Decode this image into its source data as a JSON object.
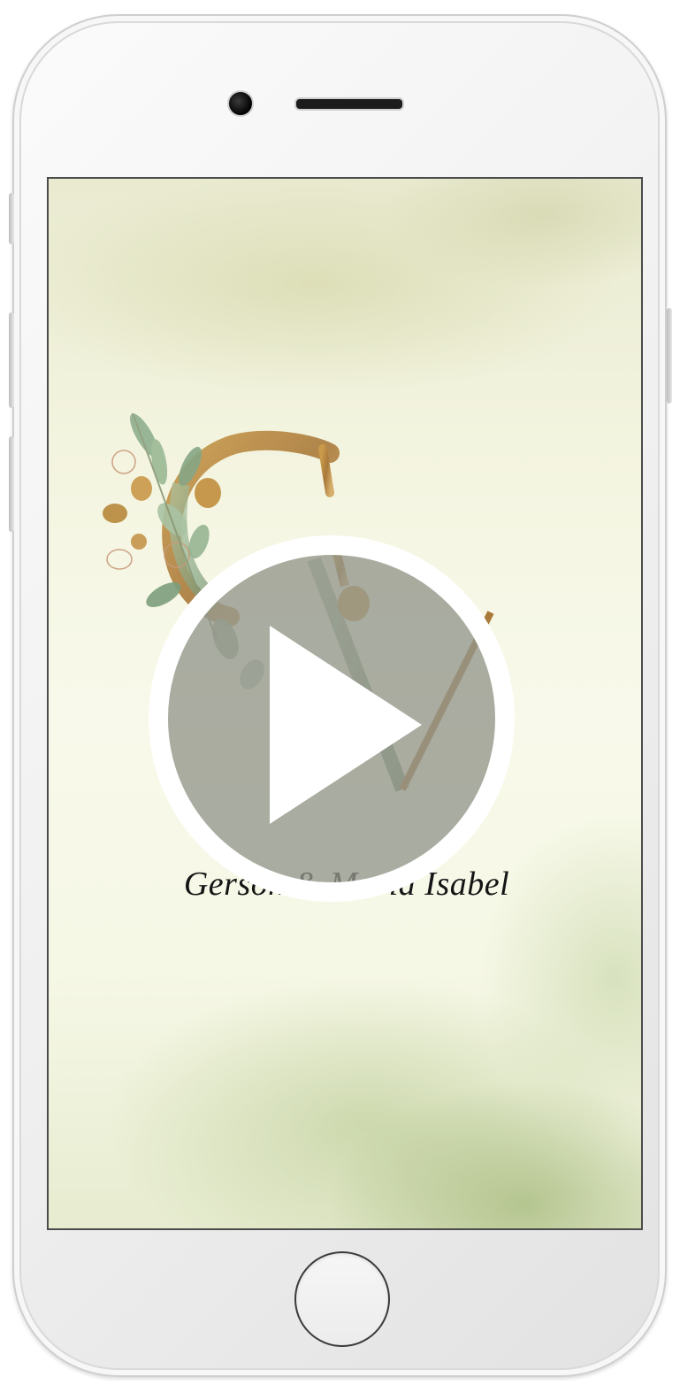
{
  "invitation": {
    "monogram_letters": "GM",
    "couple_names": "Gerson & Maria Isabel"
  },
  "video": {
    "state": "paused"
  },
  "icons": {
    "play": "play-icon",
    "camera": "front-camera-icon",
    "speaker": "earpiece-speaker-icon",
    "home": "home-button-icon"
  },
  "colors": {
    "background_cream": "#f8f9ea",
    "watercolor_green": "#8fa860",
    "gold_foil": "#b8893c",
    "leaf_green": "#8fae8c",
    "text": "#151515",
    "play_overlay": "#94968c"
  }
}
